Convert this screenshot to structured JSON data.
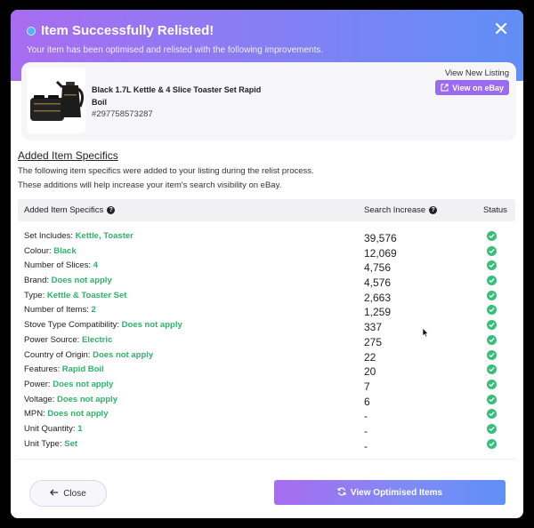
{
  "header": {
    "title": "Item Successfully Relisted!",
    "subtitle": "Your item has been optimised and relisted with the following improvements.",
    "close_icon": "close-icon"
  },
  "product": {
    "name": "Black 1.7L Kettle & 4 Slice Toaster Set Rapid Boil",
    "id": "#297758573287",
    "view_new_label": "View New Listing",
    "view_ebay_label": "View on eBay"
  },
  "section": {
    "title": "Added Item Specifics",
    "desc_line1": "The following item specifics were added to your listing during the relist process.",
    "desc_line2": "These additions will help increase your item's search visibility on eBay."
  },
  "table": {
    "headers": {
      "specifics": "Added Item Specifics",
      "search": "Search Increase",
      "status": "Status"
    },
    "rows": [
      {
        "label": "Set Includes:",
        "value": "Kettle, Toaster",
        "increase": "39,576"
      },
      {
        "label": "Colour:",
        "value": "Black",
        "increase": "12,069"
      },
      {
        "label": "Number of Slices:",
        "value": "4",
        "increase": "4,756"
      },
      {
        "label": "Brand:",
        "value": "Does not apply",
        "increase": "4,576"
      },
      {
        "label": "Type:",
        "value": "Kettle & Toaster Set",
        "increase": "2,663"
      },
      {
        "label": "Number of Items:",
        "value": "2",
        "increase": "1,259"
      },
      {
        "label": "Stove Type Compatibility:",
        "value": "Does not apply",
        "increase": "337"
      },
      {
        "label": "Power Source:",
        "value": "Electric",
        "increase": "275"
      },
      {
        "label": "Country of Origin:",
        "value": "Does not apply",
        "increase": "22"
      },
      {
        "label": "Features:",
        "value": "Rapid Boil",
        "increase": "20"
      },
      {
        "label": "Power:",
        "value": "Does not apply",
        "increase": "7"
      },
      {
        "label": "Voltage:",
        "value": "Does not apply",
        "increase": "6"
      },
      {
        "label": "MPN:",
        "value": "Does not apply",
        "increase": "-"
      },
      {
        "label": "Unit Quantity:",
        "value": "1",
        "increase": "-"
      },
      {
        "label": "Unit Type:",
        "value": "Set",
        "increase": "-"
      }
    ]
  },
  "footer": {
    "close_label": "Close",
    "primary_label": "View Optimised Items"
  },
  "colors": {
    "accent_purple": "#9a6af0",
    "accent_blue": "#5f8ff5",
    "success_green": "#35c07a",
    "value_green": "#2fb36a"
  }
}
